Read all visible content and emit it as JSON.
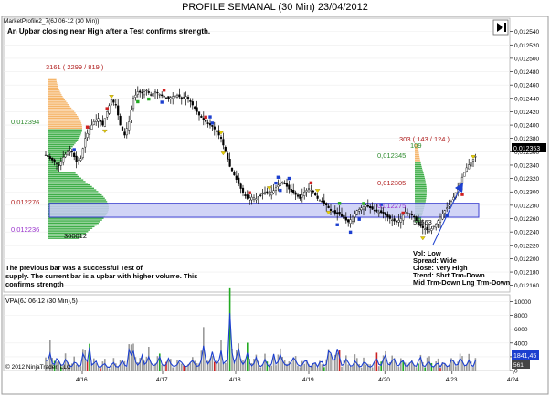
{
  "window": {
    "title": "PROFILE SEMANAL (30 Min)  23/04/2012",
    "copyright": "© 2012 NinjaTrader, LLC"
  },
  "price_panel": {
    "indicator_label": "MarketProfile2_7(6J 06-12 (30 Min))",
    "top_note": "An Upbar closing near High after a Test confirms strength.",
    "bottom_note": [
      "The previous bar was a successful Test of",
      "supply. The current bar is a upbar with higher volume. This",
      "confirms strength"
    ],
    "vol_box": [
      "Vol: Low",
      "Spread: Wide",
      "Close: Very High",
      "Trend:  Shrt Trm-Down",
      "Mid Trm-Down  Lng Trm-Down"
    ],
    "current_price": "0,012353",
    "profile_labels": [
      {
        "text": "3161 ( 2299 / 819 )",
        "color": "#b22222"
      },
      {
        "text": "0,012394",
        "color": "#2e8b2e"
      },
      {
        "text": "0,012276",
        "color": "#b22222"
      },
      {
        "text": "0,012236",
        "color": "#9932cc"
      },
      {
        "text": "360012",
        "color": "#000000"
      },
      {
        "text": "303 ( 143 / 124 )",
        "color": "#b22222"
      },
      {
        "text": "109",
        "color": "#2e8b2e"
      },
      {
        "text": "0,012345",
        "color": "#2e8b2e"
      },
      {
        "text": "0,012305",
        "color": "#b22222"
      },
      {
        "text": "0,012275",
        "color": "#9932cc"
      },
      {
        "text": "55663",
        "color": "#000000"
      }
    ]
  },
  "volume_panel": {
    "label": "VPA(6J 06-12 (30 Min),5)",
    "current_value": "1841,45",
    "current_value2": "561"
  },
  "colors": {
    "up_bar_profile": "#f5b56a",
    "profile_green": "#3fae49",
    "value_area": "#c9cdf5",
    "value_area_border": "#3b3fd0",
    "volume_line": "#1c3fcf",
    "volume_bar": "#9a9a9a",
    "volume_green": "#22aa22",
    "volume_red": "#cc2222",
    "axis_text": "#000000"
  },
  "chart_data": [
    {
      "type": "candlestick",
      "title": "PROFILE SEMANAL (30 Min)  23/04/2012",
      "instrument": "6J 06-12",
      "timeframe": "30 Min",
      "y_ticks": [
        "0,012540",
        "0,012520",
        "0,012500",
        "0,012480",
        "0,012460",
        "0,012440",
        "0,012420",
        "0,012400",
        "0,012380",
        "0,012360",
        "0,012340",
        "0,012320",
        "0,012300",
        "0,012280",
        "0,012260",
        "0,012240",
        "0,012220",
        "0,012200",
        "0,012180",
        "0,012160"
      ],
      "ylim": [
        0.01215,
        0.01256
      ],
      "x_ticks": [
        "4/16",
        "4/17",
        "4/18",
        "4/19",
        "4/20",
        "4/23",
        "4/24"
      ],
      "close_path": [
        [
          0,
          0.012355
        ],
        [
          3,
          0.01235
        ],
        [
          6,
          0.012345
        ],
        [
          9,
          0.01234
        ],
        [
          12,
          0.012352
        ],
        [
          15,
          0.01236
        ],
        [
          18,
          0.01236
        ],
        [
          21,
          0.012345
        ],
        [
          24,
          0.01235
        ],
        [
          27,
          0.01238
        ],
        [
          30,
          0.012395
        ],
        [
          33,
          0.012405
        ],
        [
          36,
          0.01241
        ],
        [
          39,
          0.0124
        ],
        [
          42,
          0.01242
        ],
        [
          45,
          0.012438
        ],
        [
          48,
          0.01243
        ],
        [
          51,
          0.0124
        ],
        [
          54,
          0.012385
        ],
        [
          57,
          0.012405
        ],
        [
          60,
          0.01244
        ],
        [
          63,
          0.01245
        ],
        [
          66,
          0.012448
        ],
        [
          69,
          0.012452
        ],
        [
          72,
          0.012445
        ],
        [
          75,
          0.01245
        ],
        [
          78,
          0.012446
        ],
        [
          81,
          0.012442
        ],
        [
          84,
          0.01244
        ],
        [
          87,
          0.012443
        ],
        [
          90,
          0.012445
        ],
        [
          93,
          0.01244
        ],
        [
          96,
          0.012443
        ],
        [
          99,
          0.012435
        ],
        [
          102,
          0.012425
        ],
        [
          105,
          0.012415
        ],
        [
          108,
          0.012408
        ],
        [
          111,
          0.012402
        ],
        [
          114,
          0.012398
        ],
        [
          117,
          0.01239
        ],
        [
          120,
          0.01238
        ],
        [
          123,
          0.01236
        ],
        [
          126,
          0.012338
        ],
        [
          129,
          0.012325
        ],
        [
          132,
          0.012312
        ],
        [
          135,
          0.012298
        ],
        [
          138,
          0.01229
        ],
        [
          141,
          0.012292
        ],
        [
          144,
          0.01229
        ],
        [
          147,
          0.012295
        ],
        [
          150,
          0.0123
        ],
        [
          153,
          0.012298
        ],
        [
          156,
          0.012302
        ],
        [
          159,
          0.01231
        ],
        [
          162,
          0.012315
        ],
        [
          165,
          0.012308
        ],
        [
          168,
          0.0123
        ],
        [
          171,
          0.012296
        ],
        [
          174,
          0.01229
        ],
        [
          177,
          0.0123
        ],
        [
          180,
          0.012305
        ],
        [
          183,
          0.0123
        ],
        [
          186,
          0.01229
        ],
        [
          189,
          0.012285
        ],
        [
          192,
          0.01228
        ],
        [
          195,
          0.012272
        ],
        [
          198,
          0.012268
        ],
        [
          201,
          0.012266
        ],
        [
          204,
          0.01226
        ],
        [
          207,
          0.012255
        ],
        [
          210,
          0.012262
        ],
        [
          213,
          0.012272
        ],
        [
          216,
          0.012276
        ],
        [
          219,
          0.01228
        ],
        [
          222,
          0.012276
        ],
        [
          225,
          0.012272
        ],
        [
          228,
          0.01227
        ],
        [
          231,
          0.012268
        ],
        [
          234,
          0.012262
        ],
        [
          237,
          0.012258
        ],
        [
          240,
          0.012255
        ],
        [
          243,
          0.01226
        ],
        [
          246,
          0.01227
        ],
        [
          249,
          0.012268
        ],
        [
          252,
          0.012262
        ],
        [
          255,
          0.012252
        ],
        [
          258,
          0.012246
        ],
        [
          261,
          0.012243
        ],
        [
          264,
          0.012245
        ],
        [
          267,
          0.012252
        ],
        [
          270,
          0.012262
        ],
        [
          273,
          0.012272
        ],
        [
          276,
          0.01228
        ],
        [
          279,
          0.012292
        ],
        [
          282,
          0.012306
        ],
        [
          285,
          0.012322
        ],
        [
          288,
          0.012336
        ],
        [
          291,
          0.012345
        ],
        [
          294,
          0.012353
        ]
      ],
      "x_range": [
        0,
        300
      ],
      "day_boundaries": [
        24,
        75,
        126,
        177,
        228,
        270
      ],
      "value_area": {
        "low": 0.012262,
        "high": 0.012283
      },
      "profile": {
        "poc": 0.012276,
        "vah": 0.012394,
        "val": 0.012236
      },
      "profile2": {
        "poc": 0.012275,
        "vah": 0.012345,
        "val": 0.012305
      }
    },
    {
      "type": "bar",
      "title": "VPA(6J 06-12 (30 Min),5)",
      "y_ticks": [
        "10000",
        "8000",
        "6000",
        "4000",
        "2000",
        "0"
      ],
      "ylim": [
        0,
        11000
      ],
      "volume_peaks": [
        [
          3,
          3100
        ],
        [
          8,
          2800
        ],
        [
          14,
          2500
        ],
        [
          20,
          1800
        ],
        [
          26,
          4300
        ],
        [
          30,
          4200
        ],
        [
          34,
          2300
        ],
        [
          40,
          1500
        ],
        [
          46,
          1800
        ],
        [
          52,
          1700
        ],
        [
          58,
          9000
        ],
        [
          60,
          3500
        ],
        [
          66,
          2800
        ],
        [
          70,
          3000
        ],
        [
          78,
          2500
        ],
        [
          84,
          2200
        ],
        [
          92,
          2100
        ],
        [
          100,
          2000
        ],
        [
          108,
          4500
        ],
        [
          114,
          3400
        ],
        [
          120,
          3600
        ],
        [
          124,
          3100
        ],
        [
          126,
          10400
        ],
        [
          132,
          4000
        ],
        [
          138,
          3200
        ],
        [
          144,
          2400
        ],
        [
          150,
          2000
        ],
        [
          156,
          3000
        ],
        [
          160,
          3400
        ],
        [
          170,
          2600
        ],
        [
          178,
          2300
        ],
        [
          184,
          1900
        ],
        [
          188,
          2200
        ],
        [
          194,
          5000
        ],
        [
          200,
          4900
        ],
        [
          206,
          2400
        ],
        [
          212,
          2100
        ],
        [
          218,
          1800
        ],
        [
          226,
          2500
        ],
        [
          232,
          3700
        ],
        [
          238,
          2700
        ],
        [
          244,
          2300
        ],
        [
          250,
          2000
        ],
        [
          256,
          3300
        ],
        [
          262,
          1900
        ],
        [
          268,
          1800
        ],
        [
          272,
          1900
        ],
        [
          278,
          2600
        ],
        [
          284,
          2800
        ],
        [
          290,
          2300
        ],
        [
          294,
          1840
        ]
      ]
    }
  ]
}
